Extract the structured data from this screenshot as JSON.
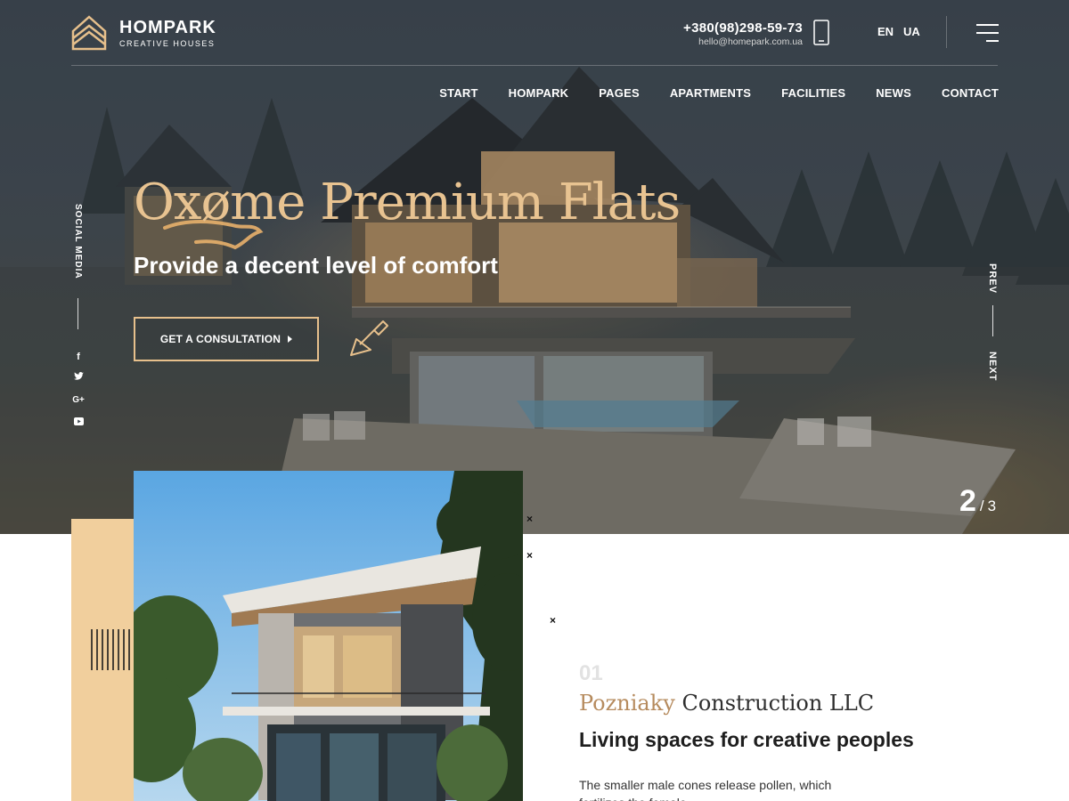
{
  "brand": {
    "name": "HOMPARK",
    "tagline": "CREATIVE HOUSES",
    "accent_color": "#e7c08c",
    "beige_color": "#f1cf9d"
  },
  "header": {
    "phone": "+380(98)298-59-73",
    "email": "hello@homepark.com.ua",
    "phone_icon": "smartphone-icon",
    "languages": [
      "EN",
      "UA"
    ],
    "menu_icon": "hamburger-menu-icon"
  },
  "nav": {
    "items": [
      "START",
      "HOMPARK",
      "PAGES",
      "APARTMENTS",
      "FACILITIES",
      "NEWS",
      "CONTACT"
    ]
  },
  "social": {
    "label": "SOCIAL MEDIA",
    "items": [
      {
        "icon": "facebook-icon",
        "glyph": "f"
      },
      {
        "icon": "twitter-icon",
        "glyph": "t"
      },
      {
        "icon": "google-plus-icon",
        "glyph": "G+"
      },
      {
        "icon": "youtube-icon",
        "glyph": "▶"
      }
    ]
  },
  "hero": {
    "title": "Oxøme Premium Flats",
    "subtitle": "Provide a decent level of comfort",
    "cta_label": "GET A CONSULTATION",
    "prev_label": "PREV",
    "next_label": "NEXT",
    "slide_current": "2",
    "slide_separator": "/",
    "slide_total": "3"
  },
  "about": {
    "number": "01",
    "company_accent": "Pozniaky",
    "company_rest": "Construction LLC",
    "heading": "Living spaces for creative peoples",
    "body": "The smaller male cones release pollen, which fertilizes the female"
  }
}
